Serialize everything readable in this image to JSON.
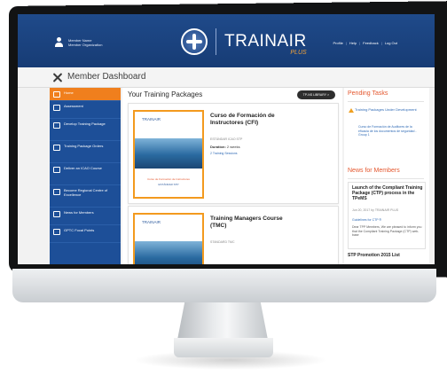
{
  "header": {
    "user_name": "Member Name",
    "user_org": "Member Organization",
    "logo_title": "TRAINAIR",
    "logo_sub": "PLUS",
    "nav": [
      "Profile",
      "Help",
      "Feedback",
      "Log Out"
    ]
  },
  "dashboard": {
    "title": "Member Dashboard"
  },
  "sidebar": {
    "items": [
      {
        "label": "Home"
      },
      {
        "label": "Assessment"
      },
      {
        "label": "Develop Training Package"
      },
      {
        "label": "Training Package Orders"
      },
      {
        "label": "Deliver an ICAO Course"
      },
      {
        "label": "Become Regional Centre of Excellence"
      },
      {
        "label": "News for Members"
      },
      {
        "label": "GPTC Focal Points"
      }
    ]
  },
  "main": {
    "title": "Your Training Packages",
    "library_button": "TP-NS LIBRARY >",
    "cards": [
      {
        "thumb_brand": "TRAINAIR",
        "thumb_caption": "Curso de Formación de Instructores",
        "thumb_caption2": "ESTÁNDAR STP",
        "title": "Curso de Formación de Instructores (CFI)",
        "code": "ESTÁNDAR ICAO STP",
        "duration_label": "Duration:",
        "duration_value": "2 weeks",
        "link": "2 Training Sessions"
      },
      {
        "thumb_brand": "TRAINAIR",
        "title": "Training Managers Course (TMC)",
        "code": "STANDARD TMC"
      }
    ]
  },
  "right": {
    "pending_title": "Pending Tasks",
    "task_text": "Training Packages Under Development",
    "task_sub": "Curso de Formación de Auditores de la eficacia de los documentos de seguridad - Group 1",
    "news_title": "News for Members",
    "news_item_title": "Launch of the Compliant Training Package (CTP) process in the TPeMS",
    "news_item_date": "Jun 20, 2017 by TRAINAIR PLUS",
    "news_item_link": "Guidelines for CTP ®",
    "news_item_body": "Dear TPP Members, We are pleased to inform you that the Compliant Training Package (CTP) web-base",
    "news_next_title": "STP Promotion 2015 List"
  }
}
